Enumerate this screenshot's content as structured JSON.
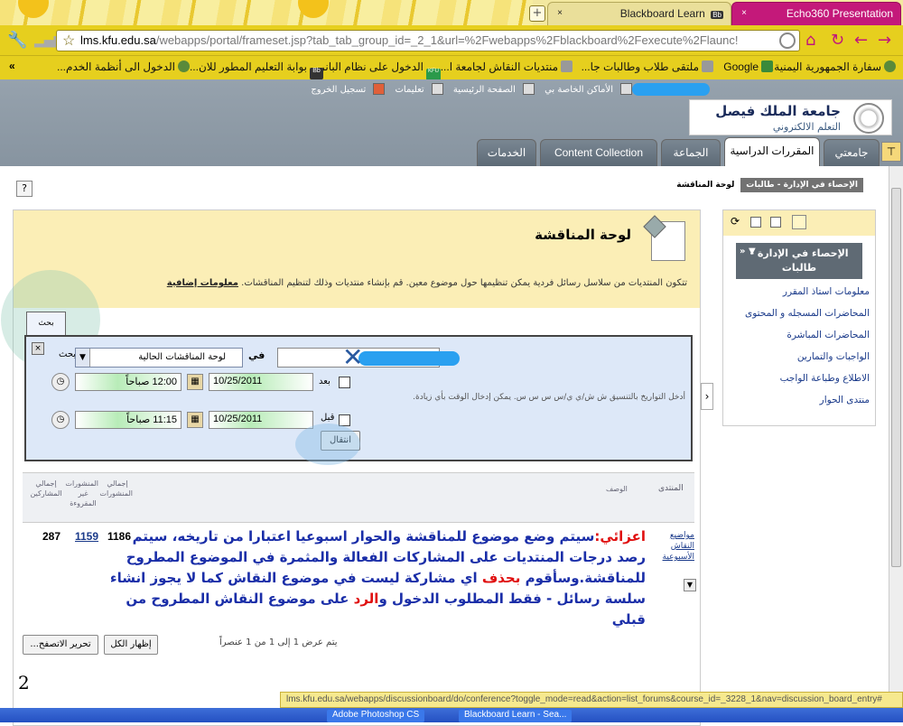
{
  "browser": {
    "tabs": [
      {
        "label": "Blackboard Learn",
        "badge": "Bb"
      },
      {
        "label": "Echo360 Presentation"
      }
    ],
    "url_domain": "lms.kfu.edu.sa",
    "url_rest": "/webapps/portal/frameset.jsp?tab_tab_group_id=_2_1&url=%2Fwebapps%2Fblackboard%2Fexecute%2Flaunc!",
    "bookmarks": [
      "سفارة الجمهورية اليمنية...",
      "Google",
      "ملتقى طلاب وطالبات جا...",
      "منتديات النقاش لجامعة ا...",
      "الدخول على نظام البانر",
      "بوابة التعليم المطور للان...",
      "الدخول الى أنظمة الخدم..."
    ],
    "overflow": "»",
    "kfu_badge": "KFU",
    "bb_badge": "Bb"
  },
  "header": {
    "toplinks": [
      "الأماكن الخاصة بي",
      "الصفحة الرئيسية",
      "تعليمات",
      "تسجيل الخروج"
    ],
    "logo_title": "جامعة الملك فيصل",
    "logo_subtitle": "التعلم الالكتروني",
    "tabs": [
      "جامعتي",
      "المقررات الدراسية",
      "الجماعة",
      "Content Collection",
      "الخدمات"
    ],
    "menu_glyph": "⊤"
  },
  "breadcrumb": {
    "course": "الإحصاء في الإدارة - طالبات",
    "page": "لوحة المناقشة"
  },
  "board": {
    "title": "لوحة المناقشة",
    "description": "تتكون المنتديات من سلاسل رسائل فردية يمكن تنظيمها حول موضوع معين. قم بإنشاء منتديات وذلك لتنظيم المناقشات.",
    "more_info": "معلومات إضافية",
    "search_tab": "بحث",
    "in_label": "في",
    "search_label": "بحث",
    "forum_select": "لوحة المناقشات الحالية",
    "after_label": "بعد",
    "before_label": "قبل",
    "after_date": "10/25/2011",
    "after_time": "12:00 صباحاً",
    "before_date": "10/25/2011",
    "before_time": "11:15 صباحاً",
    "hint": "أدخل التواريخ بالتنسيق ش ش/ي ي/س س س س. يمكن إدخال الوقت بأي زيادة.",
    "go_button": "انتقال"
  },
  "table": {
    "headers": [
      "المنتدى",
      "الوصف",
      "إجمالي المنشورات",
      "المنشورات غير المقروءة",
      "إجمالي المشاركين"
    ],
    "row": {
      "forum": "مواضيع النقاش الأسبوعية",
      "desc_intro": "اعزائي:",
      "desc_part1": "سيتم وضع موضوع للمناقشة والحوار اسبوعيا اعتبارا من تاريخه، سيتم رصد درجات المنتديات على المشاركات الفعالة والمثمرة في الموضوع المطروح للمناقشة.وسأقوم ",
      "desc_delete": "بحذف",
      "desc_part2": " اي مشاركة ليست في موضوع النقاش كما لا يجوز انشاء سلسة رسائل - فقط المطلوب الدخول و",
      "desc_reply": "الرد",
      "desc_part3": " على موضوع النقاش المطروح من قبلي",
      "total_posts": "1186",
      "unread_posts": "1159",
      "participants": "287"
    },
    "show_all": "إظهار الكل",
    "edit_paging": "تحرير الاتصفح...",
    "paging_text": "يتم عرض 1 إلى 1 من 1 عنصراً"
  },
  "sidebar": {
    "course_title": "الإحصاء في الإدارة - طالبات",
    "arrows": "▼ «",
    "items": [
      "معلومات استاذ المقرر",
      "المحاضرات المسجله و المحتوى",
      "المحاضرات المباشرة",
      "الواجبات والتمارين",
      "الاطلاع وطباعة الواجب",
      "منتدى الحوار"
    ]
  },
  "page_number": "2",
  "status_url": "lms.kfu.edu.sa/webapps/discussionboard/do/conference?toggle_mode=read&action=list_forums&course_id=_3228_1&nav=discussion_board_entry#",
  "taskbar": [
    "Adobe Photoshop CS",
    "Blackboard Learn - Sea..."
  ]
}
